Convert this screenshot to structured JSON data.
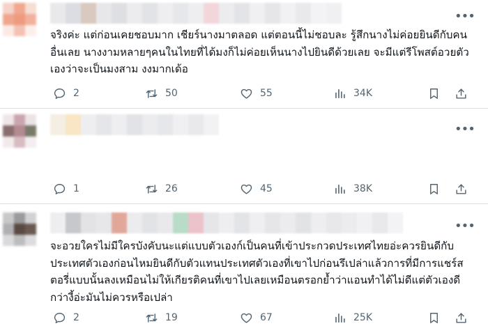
{
  "posts": [
    {
      "text": "จริงค่ะ แต่ก่อนเคยชอบมาก เชียร์นางมาตลอด แต่ตอนนี้ไม่ชอบละ รู้สึกนางไม่ค่อยยินดีกับคนอื่นเลย นางงามหลายๆคนในไทยที่ได้มงก็ไม่ค่อยเห็นนางไปยินดีด้วยเลย จะมีแต่รีโพสต์อวยตัวเองว่าจะเป็นมงสาม งงมากเด้อ",
      "replies": "2",
      "reposts": "50",
      "likes": "55",
      "views": "34K"
    },
    {
      "text": "",
      "replies": "1",
      "reposts": "26",
      "likes": "45",
      "views": "38K"
    },
    {
      "text": "จะอวยใครไม่มีใครบังคับนะแต่แบบตัวเองก์เป็นคนที่เข้าประกวดประเทศไทยอ่ะควรยินดีกับประเทศตัวเองก่อนไหมยินดีกับตัวแทนประเทศตัวเองที่เขาไปก่อนรึเปล่าแล้วการที่มีการแชร์สตอรี่แบบนั้นลงเหมือนไม่ให้เกียรติคนที่เขาไปเลยเหมือนตรอกย้ำว่าแอนทำได้ไม่ดีแต่ตัวเองดีกว่างี้อ่ะมันไม่ควรหรือเปล่า",
      "replies": "2",
      "reposts": "19",
      "likes": "67",
      "views": "25K"
    }
  ],
  "icons": {
    "more": "more-horizontal-icon",
    "reply": "reply-bubble-icon",
    "repost": "repost-arrows-icon",
    "like": "heart-icon",
    "views": "views-bar-chart-icon",
    "bookmark": "bookmark-icon",
    "share": "share-upload-icon"
  },
  "colors": {
    "icon": "#536471",
    "text": "#0f1419",
    "divider": "#d9dee2"
  }
}
